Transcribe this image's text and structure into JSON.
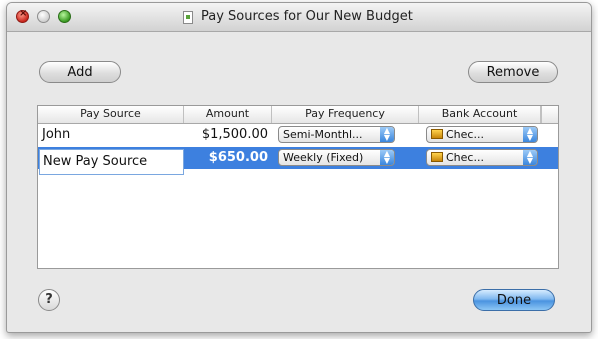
{
  "window": {
    "title": "Pay Sources for Our New Budget"
  },
  "toolbar": {
    "add_label": "Add",
    "remove_label": "Remove"
  },
  "table": {
    "columns": [
      "Pay Source",
      "Amount",
      "Pay Frequency",
      "Bank Account"
    ],
    "rows": [
      {
        "pay_source": "John",
        "amount": "$1,500.00",
        "pay_frequency": "Semi-Monthl...",
        "bank_account": "Chec...",
        "selected": false
      },
      {
        "pay_source": "New Pay Source",
        "amount": "$650.00",
        "pay_frequency": "Weekly (Fixed)",
        "bank_account": "Chec...",
        "selected": true
      }
    ]
  },
  "footer": {
    "help_label": "?",
    "done_label": "Done"
  },
  "colors": {
    "selection": "#3d80df",
    "accent": "#4a93e0"
  }
}
